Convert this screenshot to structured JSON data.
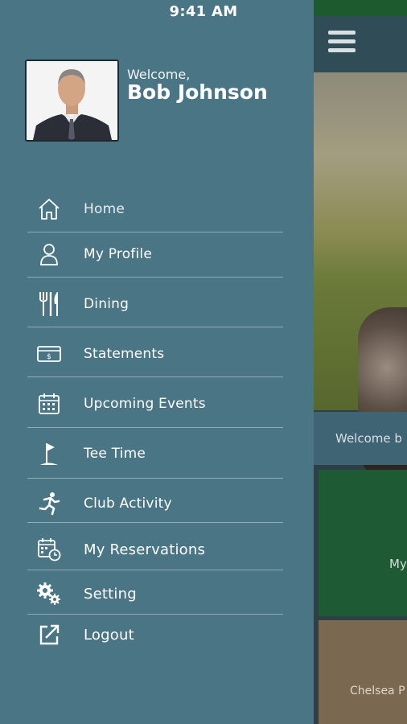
{
  "status_bar": {
    "time": "9:41 AM"
  },
  "profile": {
    "welcome": "Welcome,",
    "name": "Bob Johnson"
  },
  "menu": [
    {
      "label": "Home",
      "icon": "home-icon"
    },
    {
      "label": "My Profile",
      "icon": "person-icon"
    },
    {
      "label": "Dining",
      "icon": "dining-icon"
    },
    {
      "label": "Statements",
      "icon": "statement-icon"
    },
    {
      "label": "Upcoming Events",
      "icon": "calendar-icon"
    },
    {
      "label": "Tee Time",
      "icon": "golf-flag-icon"
    },
    {
      "label": "Club Activity",
      "icon": "running-icon"
    },
    {
      "label": "My Reservations",
      "icon": "reservation-icon"
    },
    {
      "label": "Setting",
      "icon": "gears-icon"
    },
    {
      "label": "Logout",
      "icon": "logout-icon"
    }
  ],
  "background_app": {
    "welcome_text": "Welcome b",
    "tile1_label": "My",
    "tile2_label": "Chelsea P"
  },
  "colors": {
    "drawer": "#4a7585",
    "header": "#2f4c57",
    "tile_green": "#1e5a34",
    "tile_brown": "#7a6851"
  }
}
